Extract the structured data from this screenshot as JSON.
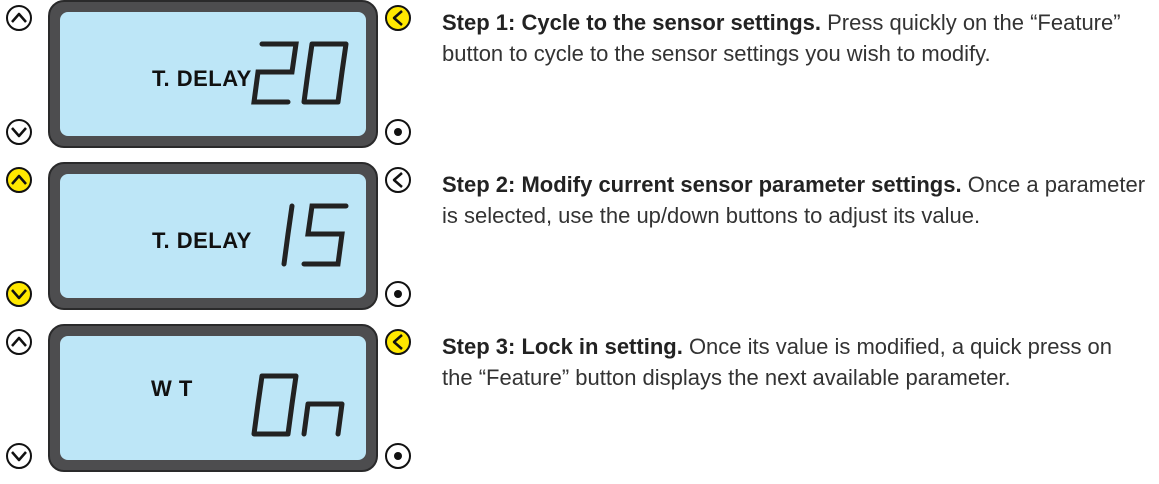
{
  "steps": [
    {
      "display_label": "T. DELAY",
      "display_value": "20",
      "highlight": "feature",
      "title": "Step 1: Cycle to the sensor settings.",
      "body": "Press quickly on the “Feature” button to cycle to the sensor settings you wish to modify."
    },
    {
      "display_label": "T. DELAY",
      "display_value": "15",
      "highlight": "updown",
      "title": "Step 2: Modify current sensor parameter settings.",
      "body": "Once a parameter is selected, use the up/down buttons to adjust its value."
    },
    {
      "display_label": "W T",
      "display_value": "On",
      "highlight": "feature",
      "title": "Step 3: Lock in setting.",
      "body": "Once its value is modified, a quick press on the “Feature” button displays the next available parameter."
    }
  ],
  "colors": {
    "highlight": "#ffe800",
    "lcd": "#bde6f7",
    "bezel": "#4d4d4f"
  },
  "icons": [
    "up-arrow-icon",
    "down-arrow-icon",
    "left-arrow-icon",
    "dot-icon"
  ]
}
